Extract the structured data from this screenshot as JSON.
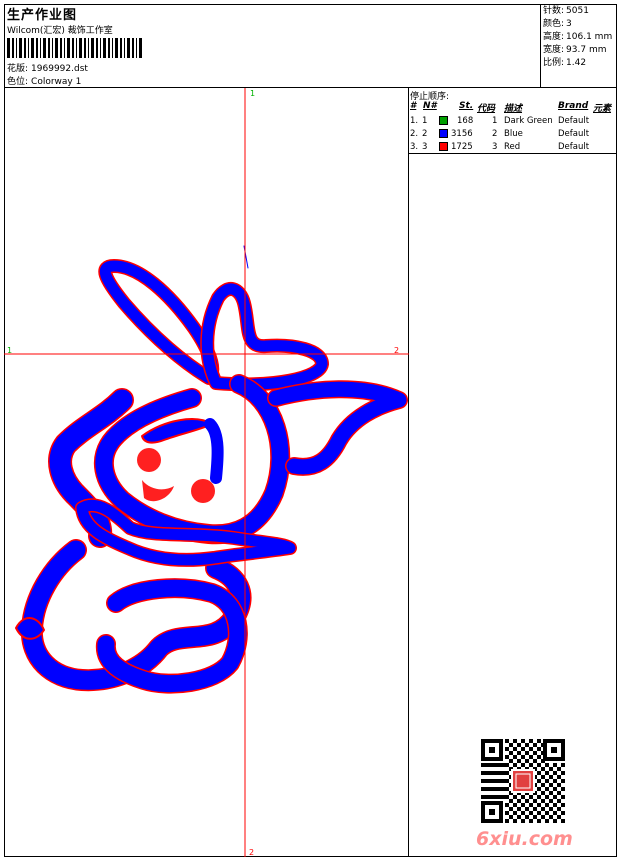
{
  "header": {
    "title": "生产作业图",
    "subtitle": "Wilcom(汇宏) 裁饰工作室",
    "design_label": "花版:",
    "design_value": "1969992.dst",
    "colorway_label": "色位:",
    "colorway_value": "Colorway 1"
  },
  "stats": [
    {
      "label": "针数:",
      "value": "5051"
    },
    {
      "label": "颜色:",
      "value": "3"
    },
    {
      "label": "高度:",
      "value": "106.1 mm"
    },
    {
      "label": "宽度:",
      "value": "93.7 mm"
    },
    {
      "label": "比例:",
      "value": "1.42"
    }
  ],
  "stop_sequence": {
    "title": "停止顺序:",
    "columns": [
      "#",
      "N#",
      "St.",
      "代码",
      "描述",
      "Brand",
      "元素"
    ],
    "rows": [
      {
        "idx": "1.",
        "n": "1",
        "color": "#00a000",
        "stitches": "168",
        "code": "1",
        "desc": "Dark Green",
        "brand": "Default"
      },
      {
        "idx": "2.",
        "n": "2",
        "color": "#0000ff",
        "stitches": "3156",
        "code": "2",
        "desc": "Blue",
        "brand": "Default"
      },
      {
        "idx": "3.",
        "n": "3",
        "color": "#ff0000",
        "stitches": "1725",
        "code": "3",
        "desc": "Red",
        "brand": "Default"
      }
    ]
  },
  "axis_markers": {
    "top": "1",
    "bottom": "2",
    "left": "1",
    "right": "2"
  },
  "colors": {
    "axis": "#ff0000",
    "marker_start": "#00b000",
    "marker_end": "#ff0000",
    "blue": "#0000ff",
    "red": "#ff0000",
    "watermark": "#ff8f8f"
  },
  "watermark": "6xiu.com"
}
